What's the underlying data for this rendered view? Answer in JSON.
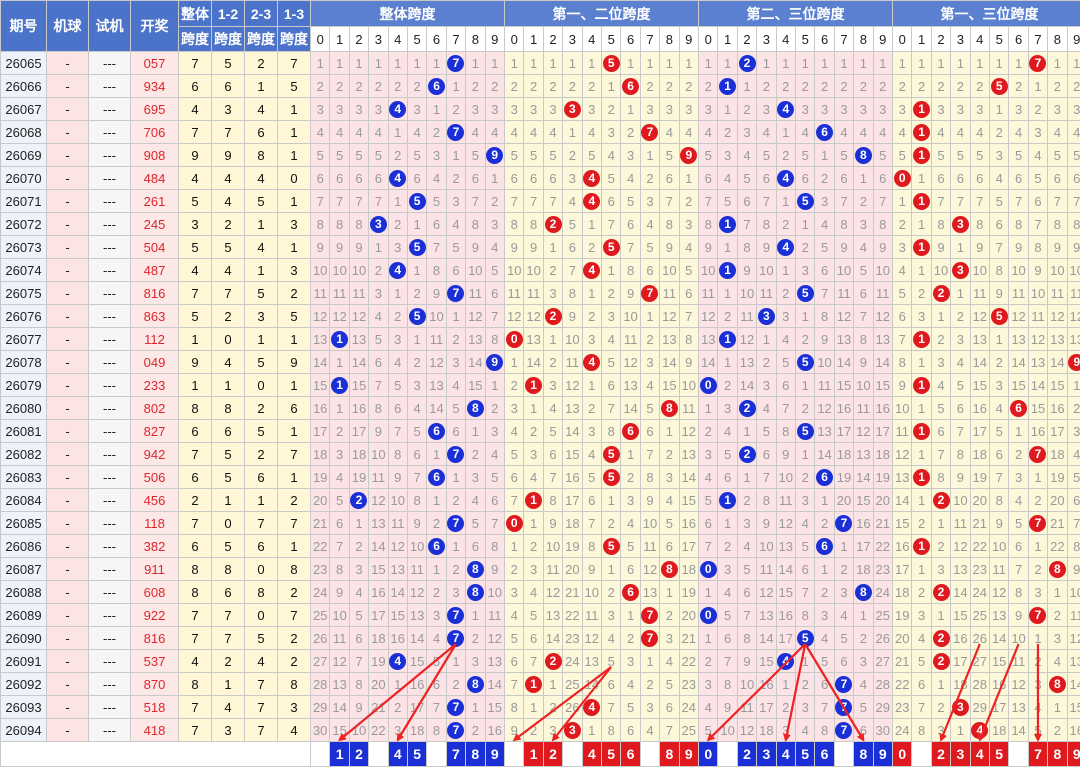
{
  "header": {
    "cols": [
      "期号",
      "机球",
      "试机",
      "开奖"
    ],
    "span_cols": [
      [
        "整体",
        "跨度"
      ],
      [
        "1-2",
        "跨度"
      ],
      [
        "2-3",
        "跨度"
      ],
      [
        "1-3",
        "跨度"
      ]
    ],
    "sections": [
      "整体跨度",
      "第一、二位跨度",
      "第二、三位跨度",
      "第一、三位跨度"
    ],
    "digits": [
      "0",
      "1",
      "2",
      "3",
      "4",
      "5",
      "6",
      "7",
      "8",
      "9"
    ]
  },
  "rows": [
    {
      "period": "26065",
      "mq": "-",
      "sj": "---",
      "kj": "057",
      "spans": [
        7,
        5,
        2,
        7
      ]
    },
    {
      "period": "26066",
      "mq": "-",
      "sj": "---",
      "kj": "934",
      "spans": [
        6,
        6,
        1,
        5
      ]
    },
    {
      "period": "26067",
      "mq": "-",
      "sj": "---",
      "kj": "695",
      "spans": [
        4,
        3,
        4,
        1
      ]
    },
    {
      "period": "26068",
      "mq": "-",
      "sj": "---",
      "kj": "706",
      "spans": [
        7,
        7,
        6,
        1
      ]
    },
    {
      "period": "26069",
      "mq": "-",
      "sj": "---",
      "kj": "908",
      "spans": [
        9,
        9,
        8,
        1
      ]
    },
    {
      "period": "26070",
      "mq": "-",
      "sj": "---",
      "kj": "484",
      "spans": [
        4,
        4,
        4,
        0
      ]
    },
    {
      "period": "26071",
      "mq": "-",
      "sj": "---",
      "kj": "261",
      "spans": [
        5,
        4,
        5,
        1
      ]
    },
    {
      "period": "26072",
      "mq": "-",
      "sj": "---",
      "kj": "245",
      "spans": [
        3,
        2,
        1,
        3
      ]
    },
    {
      "period": "26073",
      "mq": "-",
      "sj": "---",
      "kj": "504",
      "spans": [
        5,
        5,
        4,
        1
      ]
    },
    {
      "period": "26074",
      "mq": "-",
      "sj": "---",
      "kj": "487",
      "spans": [
        4,
        4,
        1,
        3
      ]
    },
    {
      "period": "26075",
      "mq": "-",
      "sj": "---",
      "kj": "816",
      "spans": [
        7,
        7,
        5,
        2
      ]
    },
    {
      "period": "26076",
      "mq": "-",
      "sj": "---",
      "kj": "863",
      "spans": [
        5,
        2,
        3,
        5
      ]
    },
    {
      "period": "26077",
      "mq": "-",
      "sj": "---",
      "kj": "112",
      "spans": [
        1,
        0,
        1,
        1
      ]
    },
    {
      "period": "26078",
      "mq": "-",
      "sj": "---",
      "kj": "049",
      "spans": [
        9,
        4,
        5,
        9
      ]
    },
    {
      "period": "26079",
      "mq": "-",
      "sj": "---",
      "kj": "233",
      "spans": [
        1,
        1,
        0,
        1
      ]
    },
    {
      "period": "26080",
      "mq": "-",
      "sj": "---",
      "kj": "802",
      "spans": [
        8,
        8,
        2,
        6
      ]
    },
    {
      "period": "26081",
      "mq": "-",
      "sj": "---",
      "kj": "827",
      "spans": [
        6,
        6,
        5,
        1
      ]
    },
    {
      "period": "26082",
      "mq": "-",
      "sj": "---",
      "kj": "942",
      "spans": [
        7,
        5,
        2,
        7
      ]
    },
    {
      "period": "26083",
      "mq": "-",
      "sj": "---",
      "kj": "506",
      "spans": [
        6,
        5,
        6,
        1
      ]
    },
    {
      "period": "26084",
      "mq": "-",
      "sj": "---",
      "kj": "456",
      "spans": [
        2,
        1,
        1,
        2
      ]
    },
    {
      "period": "26085",
      "mq": "-",
      "sj": "---",
      "kj": "118",
      "spans": [
        7,
        0,
        7,
        7
      ]
    },
    {
      "period": "26086",
      "mq": "-",
      "sj": "---",
      "kj": "382",
      "spans": [
        6,
        5,
        6,
        1
      ]
    },
    {
      "period": "26087",
      "mq": "-",
      "sj": "---",
      "kj": "911",
      "spans": [
        8,
        8,
        0,
        8
      ]
    },
    {
      "period": "26088",
      "mq": "-",
      "sj": "---",
      "kj": "608",
      "spans": [
        8,
        6,
        8,
        2
      ]
    },
    {
      "period": "26089",
      "mq": "-",
      "sj": "---",
      "kj": "922",
      "spans": [
        7,
        7,
        0,
        7
      ]
    },
    {
      "period": "26090",
      "mq": "-",
      "sj": "---",
      "kj": "816",
      "spans": [
        7,
        7,
        5,
        2
      ]
    },
    {
      "period": "26091",
      "mq": "-",
      "sj": "---",
      "kj": "537",
      "spans": [
        4,
        2,
        4,
        2
      ]
    },
    {
      "period": "26092",
      "mq": "-",
      "sj": "---",
      "kj": "870",
      "spans": [
        8,
        1,
        7,
        8
      ]
    },
    {
      "period": "26093",
      "mq": "-",
      "sj": "---",
      "kj": "518",
      "spans": [
        7,
        4,
        7,
        3
      ]
    },
    {
      "period": "26094",
      "mq": "-",
      "sj": "---",
      "kj": "418",
      "spans": [
        7,
        3,
        7,
        4
      ]
    }
  ],
  "forecast": [
    {
      "section": "整体跨度",
      "digits": [
        "1",
        "2",
        "4",
        "5",
        "7",
        "8",
        "9"
      ]
    },
    {
      "section": "第一、二位跨度",
      "digits": [
        "1",
        "2",
        "4",
        "5",
        "6",
        "8",
        "9"
      ]
    },
    {
      "section": "第二、三位跨度",
      "digits": [
        "0",
        "2",
        "3",
        "4",
        "5",
        "6",
        "8",
        "9"
      ]
    },
    {
      "section": "第一、三位跨度",
      "digits": [
        "0",
        "2",
        "3",
        "4",
        "5",
        "7",
        "8",
        "9"
      ]
    }
  ],
  "colors": {
    "header_blue": "#4b73c9",
    "ball_blue": "#1b2fd6",
    "ball_red": "#e0191f",
    "draw_text": "#e0252a",
    "span_bg": "#fff7d6",
    "pink_bg": "#fbe3e6",
    "yellow_bg": "#fcf8d9"
  }
}
